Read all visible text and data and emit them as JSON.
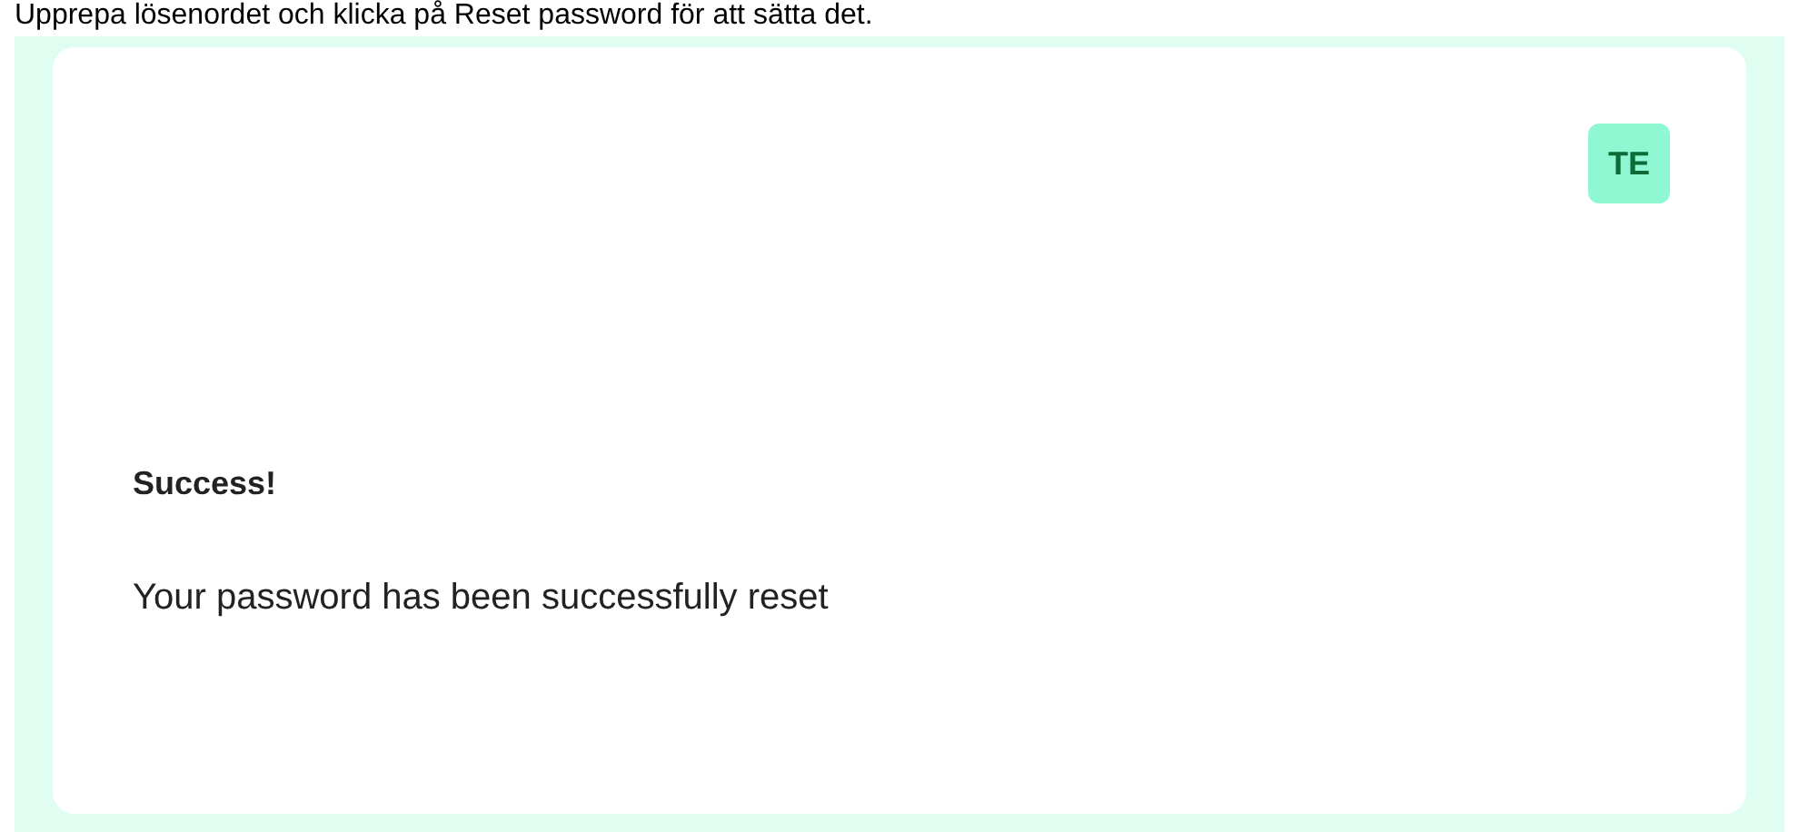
{
  "instruction": "Upprepa lösenordet och klicka på Reset password för att sätta det.",
  "logo": {
    "text": "TE"
  },
  "message": {
    "title": "Success!",
    "body": "Your password has been successfully reset"
  }
}
